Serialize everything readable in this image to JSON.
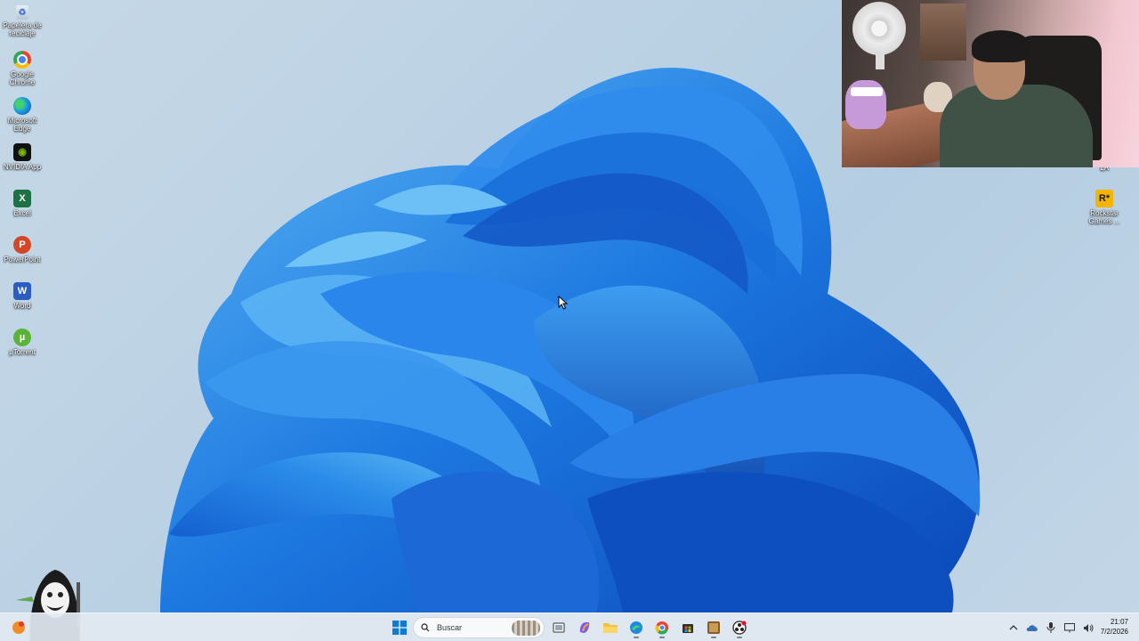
{
  "desktop": {
    "left_icons": [
      {
        "label": "Papelera de reciclaje",
        "icon": "recycle-bin-icon"
      },
      {
        "label": "Google Chrome",
        "icon": "chrome-icon"
      },
      {
        "label": "Microsoft Edge",
        "icon": "edge-icon"
      },
      {
        "label": "NVIDIA App",
        "icon": "nvidia-icon"
      },
      {
        "label": "Excel",
        "icon": "excel-icon"
      },
      {
        "label": "PowerPoint",
        "icon": "powerpoint-icon"
      },
      {
        "label": "Word",
        "icon": "word-icon"
      },
      {
        "label": "µTorrent",
        "icon": "utorrent-icon"
      }
    ],
    "right_icons": [
      {
        "label": "Rockstar Games ...",
        "icon": "rockstar-games-icon",
        "glyph": "R*"
      }
    ],
    "partial_label": "LA"
  },
  "taskbar": {
    "search_placeholder": "Buscar",
    "pinned": [
      "start-icon",
      "task-view-icon",
      "copilot-icon",
      "file-explorer-icon",
      "edge-icon",
      "chrome-icon",
      "store-icon",
      "game-icon",
      "obs-icon"
    ],
    "clock": {
      "time": "21:07",
      "date": "7/2/2026"
    },
    "tray_icons": [
      "chevron-up-icon",
      "onedrive-icon",
      "microphone-icon",
      "display-icon",
      "volume-icon"
    ]
  },
  "colors": {
    "accent": "#1a73e8",
    "bloom_light": "#4aa6f0",
    "bloom_dark": "#0a3c9c"
  }
}
